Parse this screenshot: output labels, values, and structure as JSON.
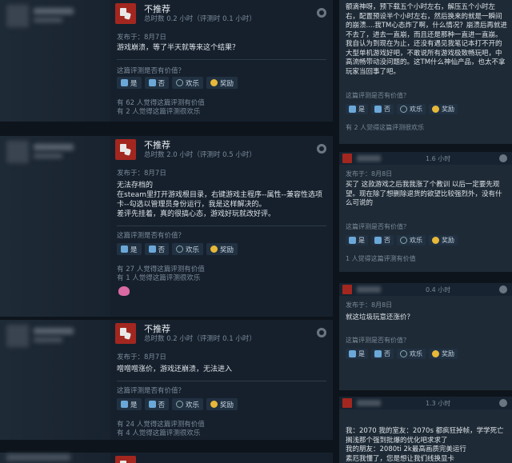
{
  "left_reviews": [
    {
      "verdict": "不推荐",
      "hours": "总时数 0.2 小时（评测时 0.1 小时）",
      "posted": "发布于：8月7日",
      "body": "游戏崩溃，等了半天就等来这个结果？",
      "help_question": "这篇评测是否有价值？",
      "yes": "是",
      "no": "否",
      "funny": "欢乐",
      "award": "奖励",
      "stat1": "有 62 人觉得这篇评测有价值",
      "stat2": "有 2 人觉得这篇评测很欢乐"
    },
    {
      "verdict": "不推荐",
      "hours": "总时数 2.0 小时（评测时 0.5 小时）",
      "posted": "发布于：8月7日",
      "body": "无法存档的\n在steam里打开游戏根目录，右键游戏主程序--属性--兼容性选项卡--勾选以管理员身份运行，我是这样解决的。\n差评先挂着，真的很搞心态，游戏好玩就改好评。",
      "help_question": "这篇评测是否有价值？",
      "yes": "是",
      "no": "否",
      "funny": "欢乐",
      "award": "奖励",
      "stat1": "有 27 人觉得这篇评测有价值",
      "stat2": "有 1 人觉得这篇评测很欢乐"
    },
    {
      "verdict": "不推荐",
      "hours": "总时数 0.2 小时（评测时 0.1 小时）",
      "posted": "发布于：8月7日",
      "body": "噌噌噌涨价，游戏还崩溃，无法进入",
      "help_question": "这篇评测是否有价值？",
      "yes": "是",
      "no": "否",
      "funny": "欢乐",
      "award": "奖励",
      "stat1": "有 24 人觉得这篇评测有价值",
      "stat2": "有 4 人觉得这篇评测很欢乐"
    }
  ],
  "right_top": {
    "body": "额滴神呀，预下载五个小时左右，解压五个小时左右，配置预设半个小时左右，然后换来的就是一瞬间的崩溃....我TM心态炸了啊，什么情况？崩溃后再就进不去了，进去一直崩，而且还是那种一直进一直崩。我自认为到现在为止，还没有遇见我笔记本打不开的大型单机游戏好吧，不敢说所有游戏极致畅玩吧，中高流畅带动没问题的。这TM什么神仙产品，也太不拿玩家当回事了吧。",
    "help_question": "这篇评测是否有价值？",
    "yes": "是",
    "no": "否",
    "funny": "欢乐",
    "award": "奖励",
    "stat1": "有 2 人觉得这篇评测很欢乐"
  },
  "right_reviews": [
    {
      "hours": "1.6 小时",
      "posted": "发布于：8月8日",
      "body": "买了 这款游戏之后我我涨了个教训 以后一定要先观望。现在除了想删除退货的欲望比较强烈外，没有什么可说的",
      "help_question": "这篇评测是否有价值？",
      "yes": "是",
      "no": "否",
      "funny": "欢乐",
      "award": "奖励",
      "stat1": "1 人觉得这篇评测有价值"
    },
    {
      "hours": "0.4 小时",
      "posted": "发布于：8月8日",
      "body": "就这垃圾玩意还涨价？",
      "help_question": "这篇评测是否有价值？",
      "yes": "是",
      "no": "否",
      "funny": "欢乐",
      "award": "奖励",
      "stat1": ""
    },
    {
      "hours": "1.3 小时",
      "posted": "发布于：8月8日",
      "body": "我：2070 我的室友：2070s 都疯狂掉帧，学学死亡搁浅那个强到批爆的优化吧求求了\n我的朋友：2080ti 2k最高画质完美运行\n素厄我懂了，您是想让我们线换显卡"
    }
  ]
}
